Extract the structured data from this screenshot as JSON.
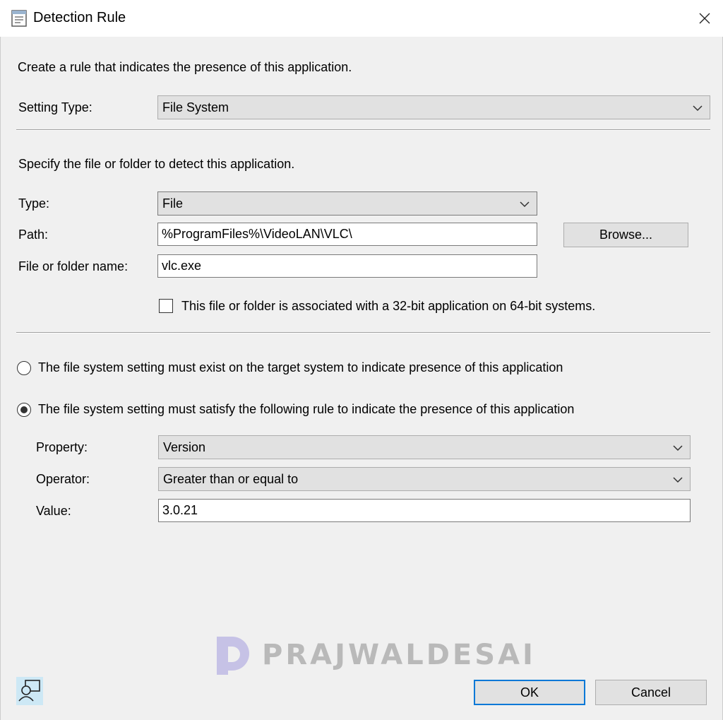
{
  "window": {
    "title": "Detection Rule"
  },
  "header": {
    "description": "Create a rule that indicates the presence of this application."
  },
  "setting_type": {
    "label": "Setting Type:",
    "value": "File System"
  },
  "file_section": {
    "description": "Specify the file or folder to detect this application.",
    "type_label": "Type:",
    "type_value": "File",
    "path_label": "Path:",
    "path_value": "%ProgramFiles%\\VideoLAN\\VLC\\",
    "browse_label": "Browse...",
    "name_label": "File or folder name:",
    "name_value": "vlc.exe",
    "checkbox_label": "This file or folder is associated with a 32-bit application on 64-bit systems.",
    "checkbox_checked": false
  },
  "rule_section": {
    "radio_exist_label": "The file system setting must exist on the target system to indicate presence of this application",
    "radio_satisfy_label": "The file system setting must satisfy the following rule to indicate the presence of this application",
    "selected": "satisfy",
    "property_label": "Property:",
    "property_value": "Version",
    "operator_label": "Operator:",
    "operator_value": "Greater than or equal to",
    "value_label": "Value:",
    "value_value": "3.0.21"
  },
  "footer": {
    "ok_label": "OK",
    "cancel_label": "Cancel"
  },
  "watermark": {
    "text": "PRAJWALDESAI"
  }
}
